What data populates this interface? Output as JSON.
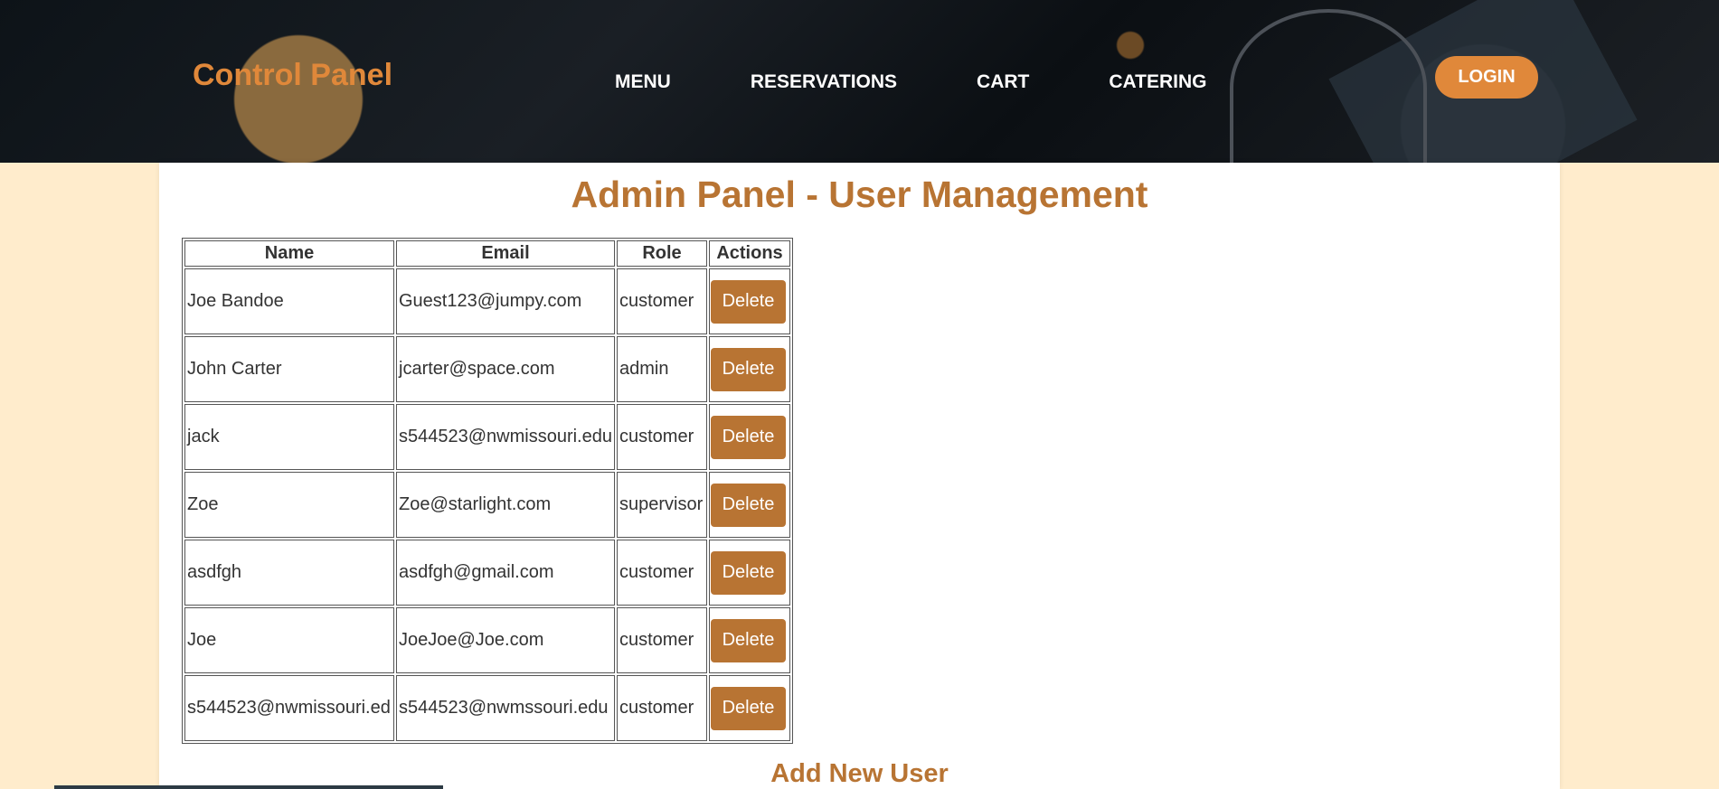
{
  "header": {
    "brand": "Control Panel",
    "nav": [
      "MENU",
      "RESERVATIONS",
      "CART",
      "CATERING"
    ],
    "login_label": "LOGIN"
  },
  "main": {
    "title": "Admin Panel - User Management",
    "table": {
      "columns": [
        "Name",
        "Email",
        "Role",
        "Actions"
      ],
      "rows": [
        {
          "name": "Joe Bandoe",
          "email": "Guest123@jumpy.com",
          "role": "customer",
          "action": "Delete"
        },
        {
          "name": "John Carter",
          "email": "jcarter@space.com",
          "role": "admin",
          "action": "Delete"
        },
        {
          "name": "jack",
          "email": "s544523@nwmissouri.edu",
          "role": "customer",
          "action": "Delete"
        },
        {
          "name": "Zoe",
          "email": "Zoe@starlight.com",
          "role": "supervisor",
          "action": "Delete"
        },
        {
          "name": "asdfgh",
          "email": "asdfgh@gmail.com",
          "role": "customer",
          "action": "Delete"
        },
        {
          "name": "Joe",
          "email": "JoeJoe@Joe.com",
          "role": "customer",
          "action": "Delete"
        },
        {
          "name": "s544523@nwmissouri.ed",
          "email": "s544523@nwmssouri.edu",
          "role": "customer",
          "action": "Delete"
        }
      ]
    },
    "add_title": "Add New User"
  },
  "colors": {
    "accent": "#e0883a",
    "heading": "#b87433",
    "page_bg": "#ffeccc"
  }
}
